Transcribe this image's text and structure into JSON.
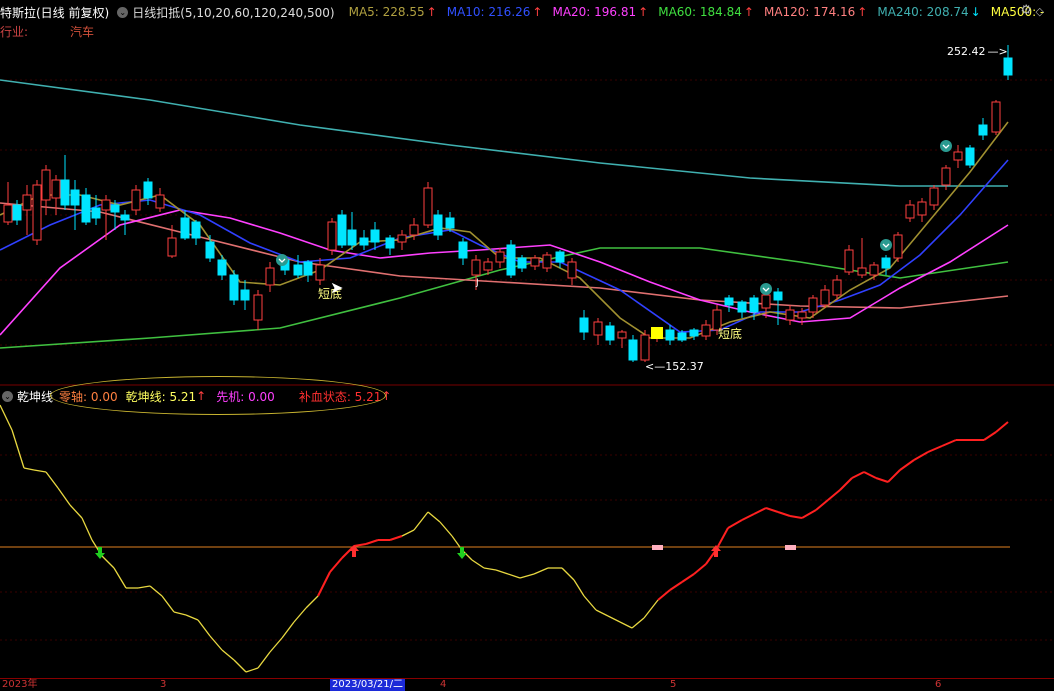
{
  "header": {
    "stock_name": "特斯拉(日线 前复权)",
    "indicator_name": "日线扣抵(5,10,20,60,120,240,500)",
    "ma": [
      {
        "label": "MA5: 228.55",
        "arrow": "↑",
        "color": "#b0a040"
      },
      {
        "label": "MA10: 216.26",
        "arrow": "↑",
        "color": "#3050ff"
      },
      {
        "label": "MA20: 196.81",
        "arrow": "↑",
        "color": "#ff40ff"
      },
      {
        "label": "MA60: 184.84",
        "arrow": "↑",
        "color": "#40e040"
      },
      {
        "label": "MA120: 174.16",
        "arrow": "↑",
        "color": "#ff8080"
      },
      {
        "label": "MA240: 208.74",
        "arrow": "↓",
        "color": "#40b0b0"
      },
      {
        "label": "MA500: -",
        "arrow": "",
        "color": "#ffff40"
      }
    ],
    "industry_label": "行业:",
    "industry_value": "汽车"
  },
  "annotations": {
    "high_price": "252.42",
    "low_price": "152.37",
    "short_bottom_1": "短底",
    "short_bottom_2": "短底"
  },
  "indicator": {
    "name": "乾坤线",
    "zero_axis": "零轴: 0.00",
    "qiankun": "乾坤线: 5.21",
    "qiankun_arrow": "↑",
    "xianji": "先机: 0.00",
    "buxue": "补血状态: 5.21",
    "buxue_arrow": "↑"
  },
  "xaxis": [
    {
      "label": "2023年",
      "pos": 2
    },
    {
      "label": "3",
      "pos": 160
    },
    {
      "label": "2023/03/21/二",
      "pos": 330,
      "selected": true
    },
    {
      "label": "4",
      "pos": 440
    },
    {
      "label": "5",
      "pos": 670
    },
    {
      "label": "6",
      "pos": 935
    }
  ],
  "colors": {
    "up": "#ff4040",
    "down": "#00e5ff",
    "bg": "#000000",
    "grid": "#7a0000"
  }
}
